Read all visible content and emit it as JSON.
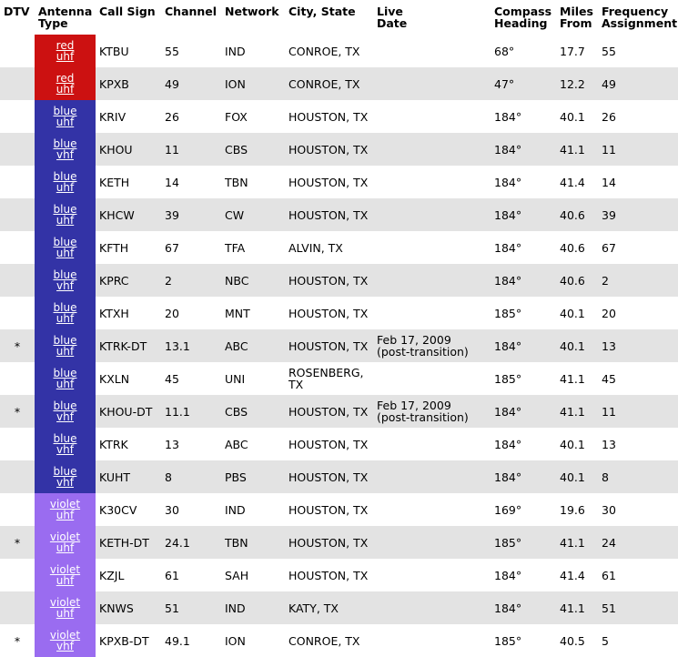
{
  "headers": {
    "dtv": "DTV",
    "antenna": [
      "Antenna",
      "Type"
    ],
    "call_sign": "Call Sign",
    "channel": "Channel",
    "network": "Network",
    "city": "City, State",
    "live": [
      "Live",
      "Date"
    ],
    "compass": [
      "Compass",
      "Heading"
    ],
    "miles": [
      "Miles",
      "From"
    ],
    "frequency": [
      "Frequency",
      "Assignment"
    ]
  },
  "rows": [
    {
      "dtv": "",
      "color": "red",
      "band": "uhf",
      "call": "KTBU",
      "channel": "55",
      "network": "IND",
      "city": "CONROE, TX",
      "live": "",
      "live2": "",
      "heading": "68°",
      "miles": "17.7",
      "freq": "55"
    },
    {
      "dtv": "",
      "color": "red",
      "band": "uhf",
      "call": "KPXB",
      "channel": "49",
      "network": "ION",
      "city": "CONROE, TX",
      "live": "",
      "live2": "",
      "heading": "47°",
      "miles": "12.2",
      "freq": "49"
    },
    {
      "dtv": "",
      "color": "blue",
      "band": "uhf",
      "call": "KRIV",
      "channel": "26",
      "network": "FOX",
      "city": "HOUSTON, TX",
      "live": "",
      "live2": "",
      "heading": "184°",
      "miles": "40.1",
      "freq": "26"
    },
    {
      "dtv": "",
      "color": "blue",
      "band": "vhf",
      "call": "KHOU",
      "channel": "11",
      "network": "CBS",
      "city": "HOUSTON, TX",
      "live": "",
      "live2": "",
      "heading": "184°",
      "miles": "41.1",
      "freq": "11"
    },
    {
      "dtv": "",
      "color": "blue",
      "band": "uhf",
      "call": "KETH",
      "channel": "14",
      "network": "TBN",
      "city": "HOUSTON, TX",
      "live": "",
      "live2": "",
      "heading": "184°",
      "miles": "41.4",
      "freq": "14"
    },
    {
      "dtv": "",
      "color": "blue",
      "band": "uhf",
      "call": "KHCW",
      "channel": "39",
      "network": "CW",
      "city": "HOUSTON, TX",
      "live": "",
      "live2": "",
      "heading": "184°",
      "miles": "40.6",
      "freq": "39"
    },
    {
      "dtv": "",
      "color": "blue",
      "band": "uhf",
      "call": "KFTH",
      "channel": "67",
      "network": "TFA",
      "city": "ALVIN, TX",
      "live": "",
      "live2": "",
      "heading": "184°",
      "miles": "40.6",
      "freq": "67"
    },
    {
      "dtv": "",
      "color": "blue",
      "band": "vhf",
      "call": "KPRC",
      "channel": "2",
      "network": "NBC",
      "city": "HOUSTON, TX",
      "live": "",
      "live2": "",
      "heading": "184°",
      "miles": "40.6",
      "freq": "2"
    },
    {
      "dtv": "",
      "color": "blue",
      "band": "uhf",
      "call": "KTXH",
      "channel": "20",
      "network": "MNT",
      "city": "HOUSTON, TX",
      "live": "",
      "live2": "",
      "heading": "185°",
      "miles": "40.1",
      "freq": "20"
    },
    {
      "dtv": "*",
      "color": "blue",
      "band": "uhf",
      "call": "KTRK-DT",
      "channel": "13.1",
      "network": "ABC",
      "city": "HOUSTON, TX",
      "live": "Feb 17, 2009",
      "live2": "(post-transition)",
      "heading": "184°",
      "miles": "40.1",
      "freq": "13"
    },
    {
      "dtv": "",
      "color": "blue",
      "band": "uhf",
      "call": "KXLN",
      "channel": "45",
      "network": "UNI",
      "city": "ROSENBERG, TX",
      "live": "",
      "live2": "",
      "heading": "185°",
      "miles": "41.1",
      "freq": "45"
    },
    {
      "dtv": "*",
      "color": "blue",
      "band": "vhf",
      "call": "KHOU-DT",
      "channel": "11.1",
      "network": "CBS",
      "city": "HOUSTON, TX",
      "live": "Feb 17, 2009",
      "live2": "(post-transition)",
      "heading": "184°",
      "miles": "41.1",
      "freq": "11"
    },
    {
      "dtv": "",
      "color": "blue",
      "band": "vhf",
      "call": "KTRK",
      "channel": "13",
      "network": "ABC",
      "city": "HOUSTON, TX",
      "live": "",
      "live2": "",
      "heading": "184°",
      "miles": "40.1",
      "freq": "13"
    },
    {
      "dtv": "",
      "color": "blue",
      "band": "vhf",
      "call": "KUHT",
      "channel": "8",
      "network": "PBS",
      "city": "HOUSTON, TX",
      "live": "",
      "live2": "",
      "heading": "184°",
      "miles": "40.1",
      "freq": "8"
    },
    {
      "dtv": "",
      "color": "violet",
      "band": "uhf",
      "call": "K30CV",
      "channel": "30",
      "network": "IND",
      "city": "HOUSTON, TX",
      "live": "",
      "live2": "",
      "heading": "169°",
      "miles": "19.6",
      "freq": "30"
    },
    {
      "dtv": "*",
      "color": "violet",
      "band": "uhf",
      "call": "KETH-DT",
      "channel": "24.1",
      "network": "TBN",
      "city": "HOUSTON, TX",
      "live": "",
      "live2": "",
      "heading": "185°",
      "miles": "41.1",
      "freq": "24"
    },
    {
      "dtv": "",
      "color": "violet",
      "band": "uhf",
      "call": "KZJL",
      "channel": "61",
      "network": "SAH",
      "city": "HOUSTON, TX",
      "live": "",
      "live2": "",
      "heading": "184°",
      "miles": "41.4",
      "freq": "61"
    },
    {
      "dtv": "",
      "color": "violet",
      "band": "uhf",
      "call": "KNWS",
      "channel": "51",
      "network": "IND",
      "city": "KATY, TX",
      "live": "",
      "live2": "",
      "heading": "184°",
      "miles": "41.1",
      "freq": "51"
    },
    {
      "dtv": "*",
      "color": "violet",
      "band": "vhf",
      "call": "KPXB-DT",
      "channel": "49.1",
      "network": "ION",
      "city": "CONROE, TX",
      "live": "",
      "live2": "",
      "heading": "185°",
      "miles": "40.5",
      "freq": "5"
    }
  ]
}
